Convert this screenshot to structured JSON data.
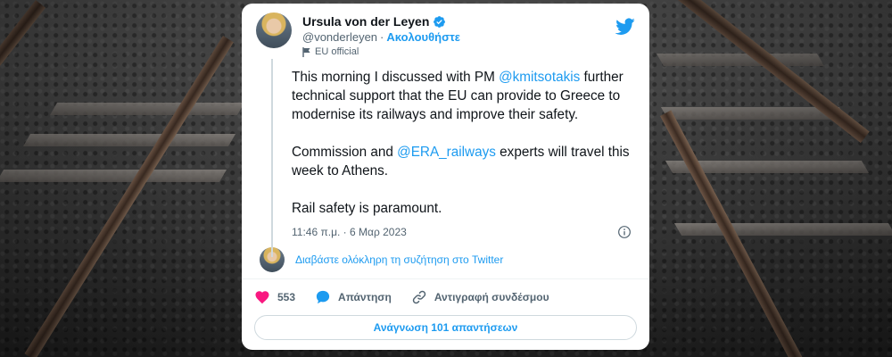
{
  "tweet": {
    "author": {
      "display_name": "Ursula von der Leyen",
      "handle": "@vonderleyen",
      "follow_label": "Ακολουθήστε",
      "affiliation_label": "EU official"
    },
    "paragraphs": [
      {
        "parts": [
          {
            "text": "This morning I discussed with PM ",
            "type": "text"
          },
          {
            "text": "@kmitsotakis",
            "type": "mention"
          },
          {
            "text": " further technical support that the EU can provide to Greece to modernise its railways and improve their safety.",
            "type": "text"
          }
        ]
      },
      {
        "parts": [
          {
            "text": "Commission and ",
            "type": "text"
          },
          {
            "text": "@ERA_railways",
            "type": "mention"
          },
          {
            "text": " experts will travel this week to Athens.",
            "type": "text"
          }
        ]
      },
      {
        "parts": [
          {
            "text": "Rail safety is paramount.",
            "type": "text"
          }
        ]
      }
    ],
    "timestamp": "11:46 π.μ. · 6 Μαρ 2023",
    "conversation_link": "Διαβάστε ολόκληρη τη συζήτηση στο Twitter",
    "actions": {
      "likes_count": "553",
      "reply_label": "Απάντηση",
      "copy_link_label": "Αντιγραφή συνδέσμου"
    },
    "read_replies_label": "Ανάγνωση 101 απαντήσεων"
  },
  "colors": {
    "accent": "#1d9bf0",
    "like": "#f91880",
    "muted": "#536471",
    "text": "#0f1419"
  },
  "icons": {
    "verified": "verified-badge-icon",
    "logo": "twitter-bird-icon",
    "flag": "flag-icon",
    "info": "info-icon",
    "heart": "heart-icon",
    "reply": "reply-bubble-icon",
    "link": "link-icon"
  }
}
